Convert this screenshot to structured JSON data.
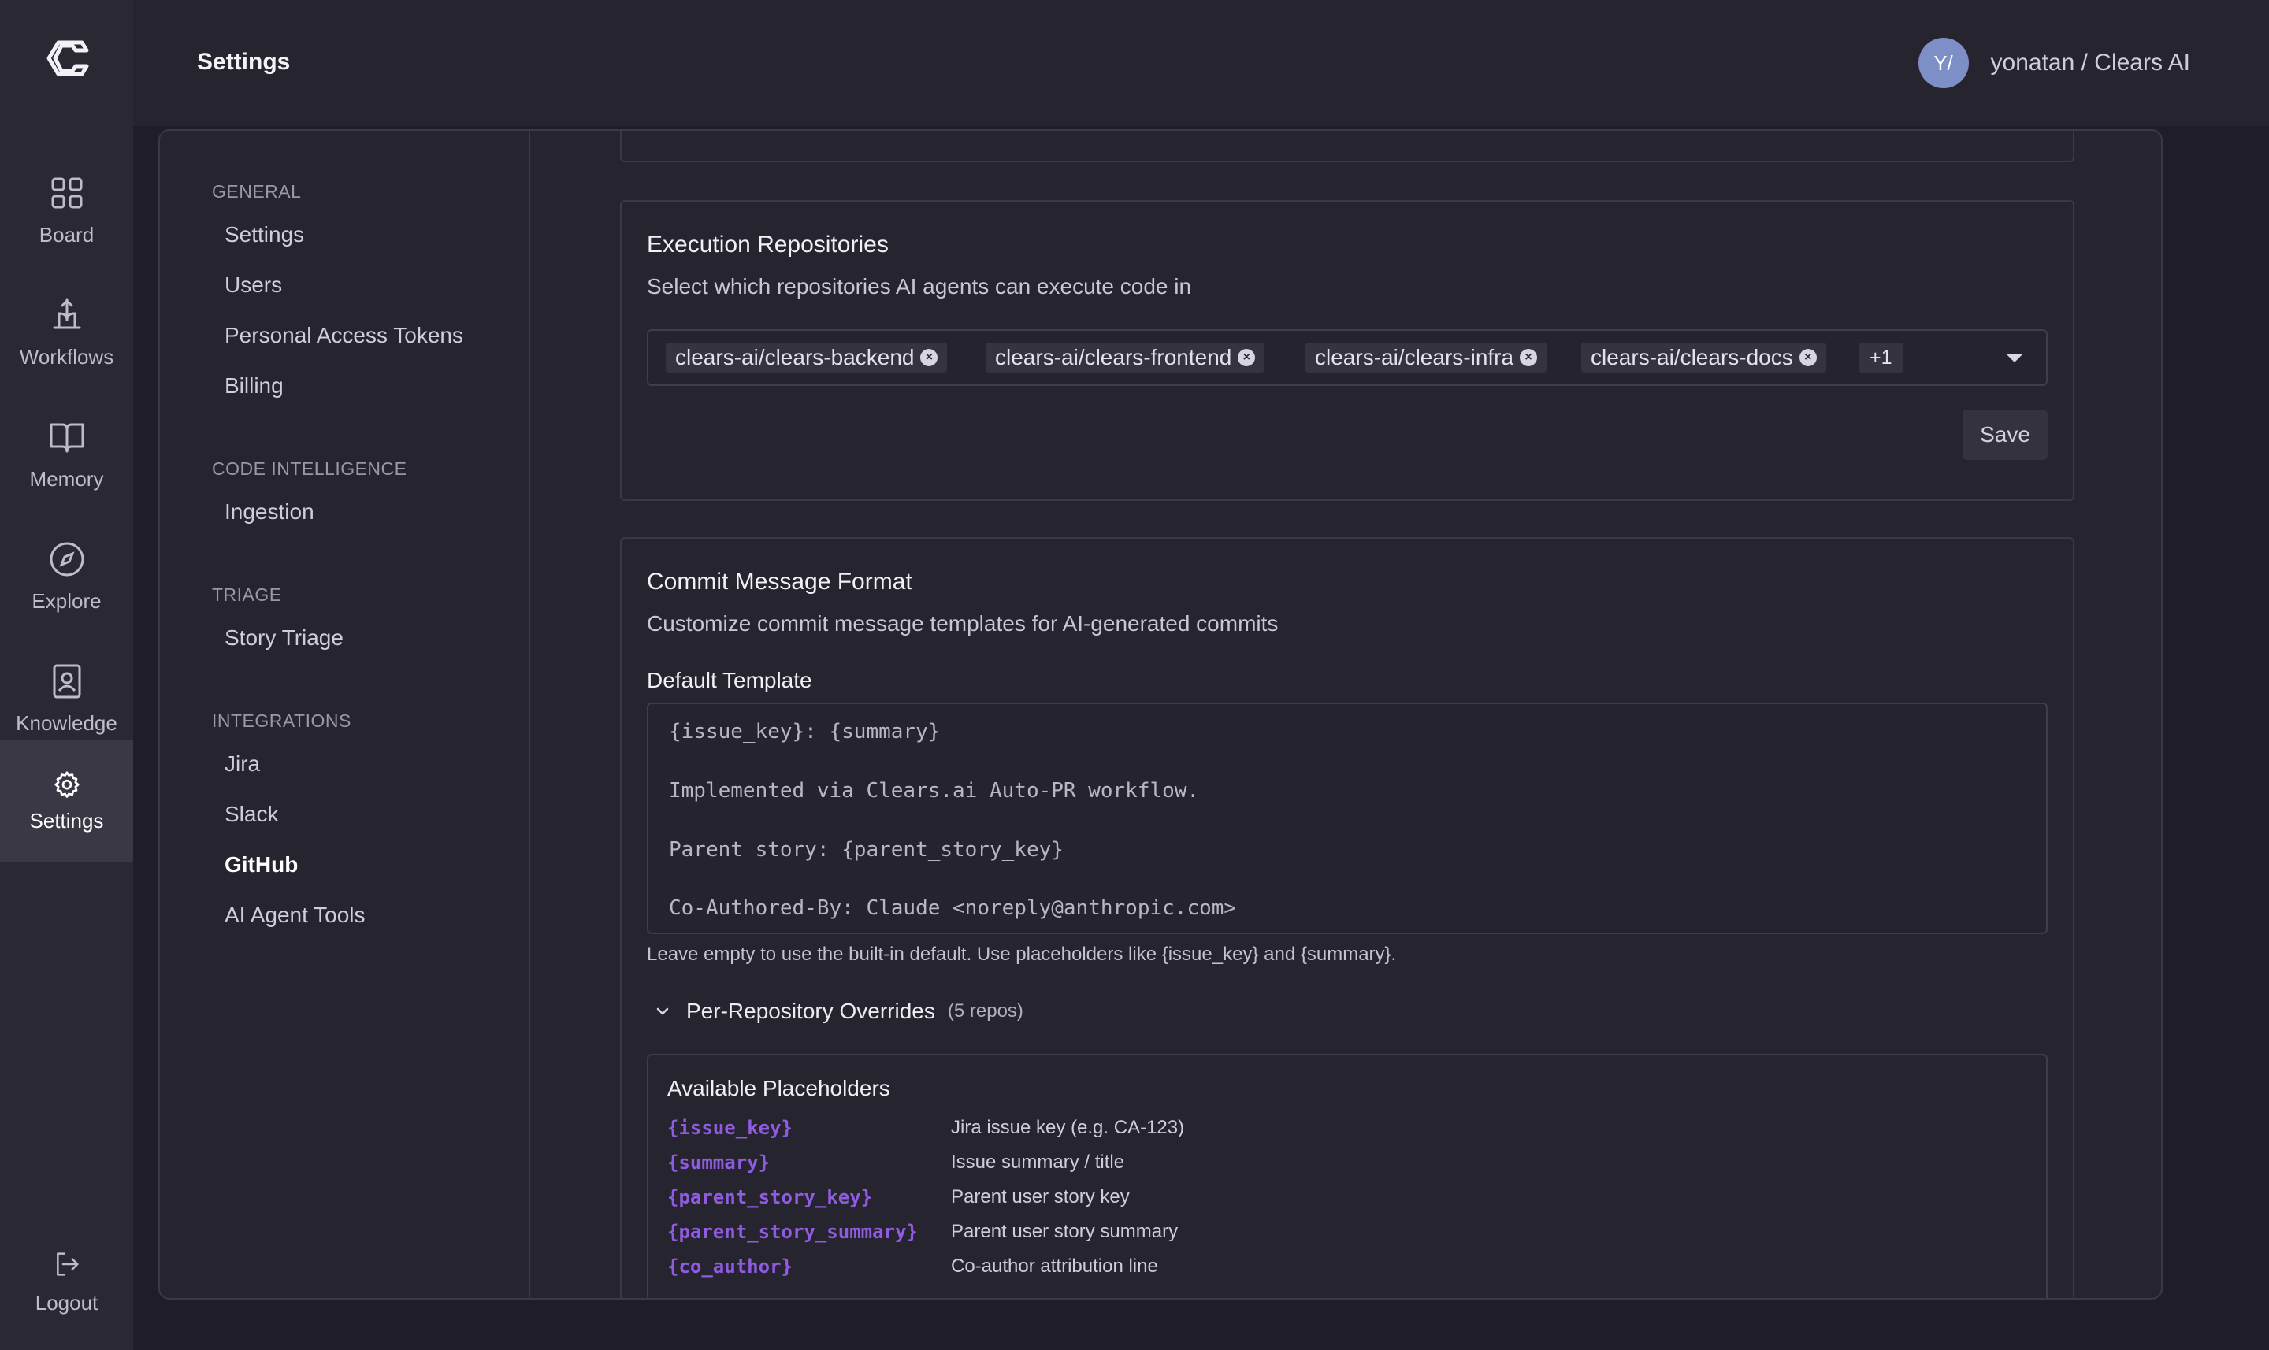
{
  "rail": {
    "items": [
      {
        "label": "Board",
        "icon": "grid-icon"
      },
      {
        "label": "Workflows",
        "icon": "workflow-icon"
      },
      {
        "label": "Memory",
        "icon": "book-icon"
      },
      {
        "label": "Explore",
        "icon": "compass-icon"
      },
      {
        "label": "Knowledge",
        "icon": "contact-book-icon"
      },
      {
        "label": "Settings",
        "icon": "gear-icon",
        "active": true
      }
    ],
    "logout": "Logout"
  },
  "header": {
    "title": "Settings",
    "avatar_initials": "Y/",
    "user": "yonatan / Clears AI"
  },
  "subnav": {
    "sections": [
      {
        "label": "GENERAL",
        "items": [
          "Settings",
          "Users",
          "Personal Access Tokens",
          "Billing"
        ]
      },
      {
        "label": "CODE INTELLIGENCE",
        "items": [
          "Ingestion"
        ]
      },
      {
        "label": "TRIAGE",
        "items": [
          "Story Triage"
        ]
      },
      {
        "label": "INTEGRATIONS",
        "items": [
          "Jira",
          "Slack",
          "GitHub",
          "AI Agent Tools"
        ]
      }
    ],
    "active": "GitHub"
  },
  "exec_repos": {
    "title": "Execution Repositories",
    "description": "Select which repositories AI agents can execute code in",
    "chips": [
      "clears-ai/clears-backend",
      "clears-ai/clears-frontend",
      "clears-ai/clears-infra",
      "clears-ai/clears-docs"
    ],
    "more": "+1",
    "save": "Save"
  },
  "commit": {
    "title": "Commit Message Format",
    "description": "Customize commit message templates for AI-generated commits",
    "template_label": "Default Template",
    "template_lines": [
      "{issue_key}: {summary}",
      "Implemented via Clears.ai Auto-PR workflow.",
      "Parent story: {parent_story_key}",
      "Co-Authored-By: Claude <noreply@anthropic.com>"
    ],
    "hint": "Leave empty to use the built-in default. Use placeholders like {issue_key} and {summary}.",
    "overrides_label": "Per-Repository Overrides",
    "overrides_count": "(5 repos)",
    "placeholders_title": "Available Placeholders",
    "placeholders": [
      {
        "key": "{issue_key}",
        "desc": "Jira issue key (e.g. CA-123)"
      },
      {
        "key": "{summary}",
        "desc": "Issue summary / title"
      },
      {
        "key": "{parent_story_key}",
        "desc": "Parent user story key"
      },
      {
        "key": "{parent_story_summary}",
        "desc": "Parent user story summary"
      },
      {
        "key": "{co_author}",
        "desc": "Co-author attribution line"
      }
    ]
  },
  "colors": {
    "accent_purple": "#8f5be0",
    "avatar": "#7d8fc6",
    "background": "#1f1d27"
  }
}
